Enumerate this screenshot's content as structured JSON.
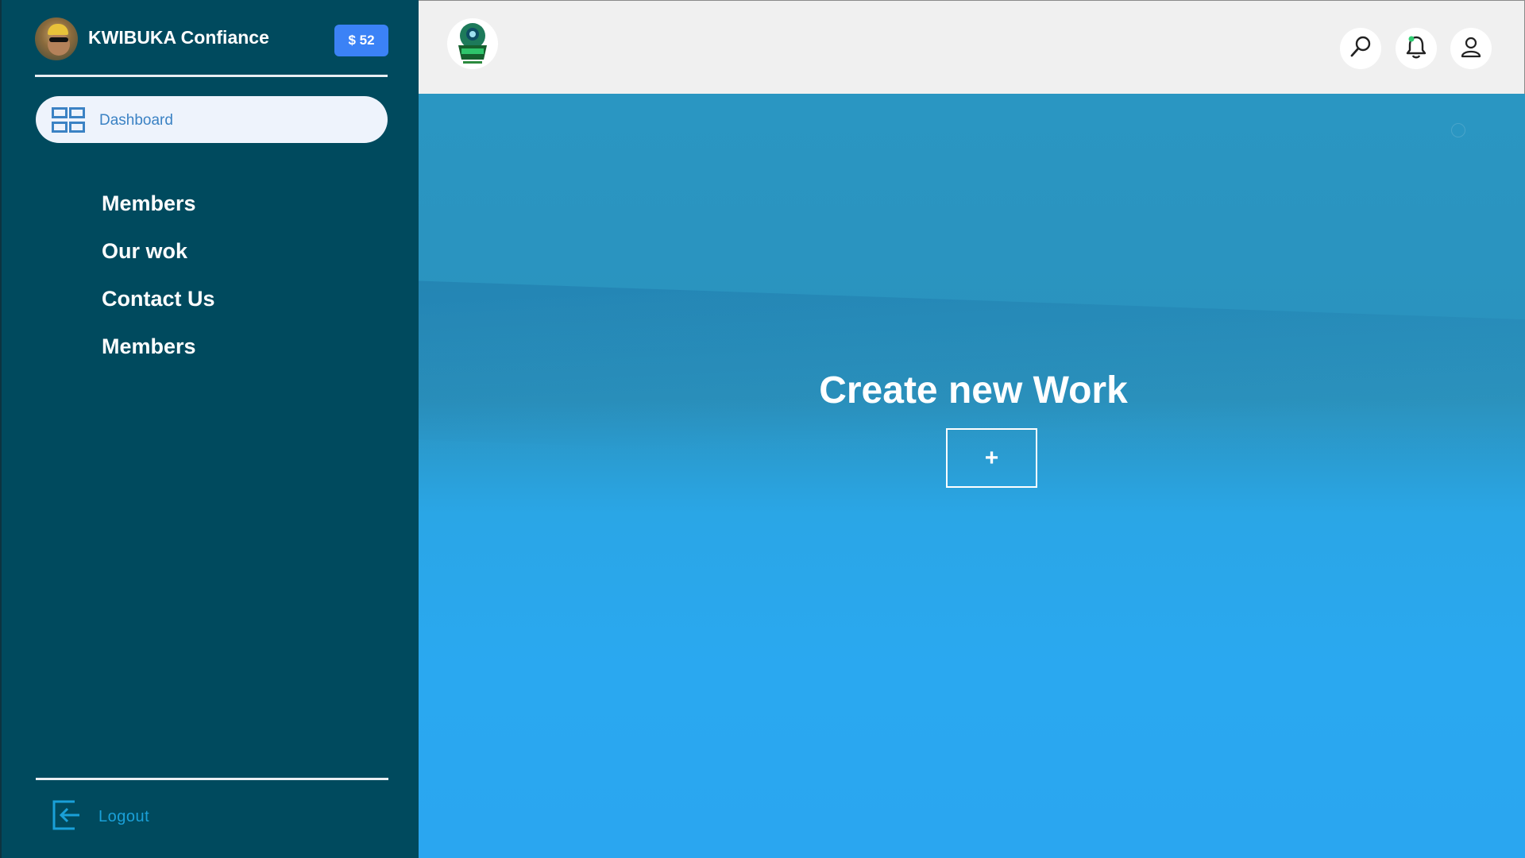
{
  "sidebar": {
    "user_name": "KWIBUKA Confiance",
    "balance": "$ 52",
    "dashboard_label": "Dashboard",
    "nav_items": [
      {
        "label": "Members"
      },
      {
        "label": "Our wok"
      },
      {
        "label": "Contact Us"
      },
      {
        "label": "Members"
      }
    ],
    "logout_label": "Logout"
  },
  "topbar": {
    "icons": [
      "search-icon",
      "bell-icon",
      "user-icon"
    ]
  },
  "main": {
    "title": "Create new Work",
    "create_button_label": "+"
  },
  "colors": {
    "sidebar_bg": "#004a5e",
    "balance_badge": "#3b82f6",
    "topbar_bg": "#f0f0f0",
    "main_bg_top": "#2a96c2",
    "main_bg_bottom": "#2aa8f0",
    "notification_dot": "#2ecc71",
    "logout_accent": "#1aa0d8"
  }
}
